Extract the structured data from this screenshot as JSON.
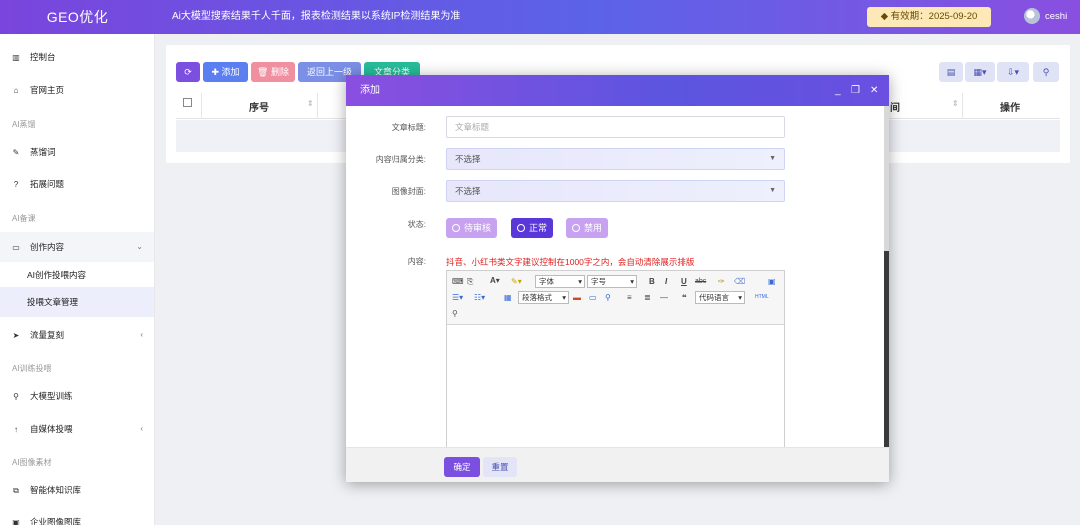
{
  "header": {
    "brand": "GEO优化",
    "slogan": "Ai大模型搜索结果千人千面，报表检测结果以系统IP检测结果为准",
    "expiry": "有效期：2025-09-20",
    "username": "ceshi",
    "accent_color": "#6a4fe0"
  },
  "sidebar": {
    "items": [
      {
        "icon": "bar-chart-icon",
        "glyph": "▥",
        "label": "控制台"
      },
      {
        "icon": "home-icon",
        "glyph": "⌂",
        "label": "官网主页"
      },
      {
        "group": "AI蒸馏"
      },
      {
        "icon": "pencil-icon",
        "glyph": "✎",
        "label": "蒸馏词"
      },
      {
        "icon": "question-icon",
        "glyph": "?",
        "label": "拓展问题"
      },
      {
        "group": "AI备课"
      },
      {
        "icon": "folder-open-icon",
        "glyph": "▭",
        "label": "创作内容",
        "arrow": "⌄"
      },
      {
        "sub": true,
        "label": "AI创作投喂内容"
      },
      {
        "sub": true,
        "label": "投喂文章管理",
        "selected": true
      },
      {
        "icon": "send-icon",
        "glyph": "➤",
        "label": "流量复刻",
        "arrow": "‹"
      },
      {
        "group": "AI训练投喂"
      },
      {
        "icon": "search-icon",
        "glyph": "⚲",
        "label": "大模型训练"
      },
      {
        "icon": "arrow-up-icon",
        "glyph": "↑",
        "label": "自媒体投喂",
        "arrow": "‹"
      },
      {
        "group": "AI图像素材"
      },
      {
        "icon": "copy-icon",
        "glyph": "⧉",
        "label": "智能体知识库"
      },
      {
        "icon": "image-icon",
        "glyph": "▣",
        "label": "企业图像图库"
      }
    ]
  },
  "toolbar": {
    "refresh": "⟳",
    "add": "✚ 添加",
    "delete": "🗑 删除",
    "back": "返回上一级",
    "category": "文章分类"
  },
  "table": {
    "headers": [
      "序号",
      "间",
      "操作"
    ]
  },
  "modal": {
    "title": "添加",
    "minimize": "_",
    "maximize": "❐",
    "close": "✕",
    "fields": {
      "title_label": "文章标题:",
      "title_placeholder": "文章标题",
      "category_label": "内容归属分类:",
      "category_value": "不选择",
      "cover_label": "图像封面:",
      "cover_value": "不选择",
      "status_label": "状态:",
      "status_options": [
        "待审核",
        "正常",
        "禁用"
      ],
      "status_selected": "正常",
      "content_label": "内容:",
      "content_hint": "抖音、小红书类文字建议控制在1000字之内，会自动清除展示排版"
    },
    "editor": {
      "font_family": "字体",
      "font_size": "字号",
      "paragraph": "段落格式",
      "code_lang": "代码语言"
    },
    "confirm": "确定",
    "reset": "重置"
  }
}
